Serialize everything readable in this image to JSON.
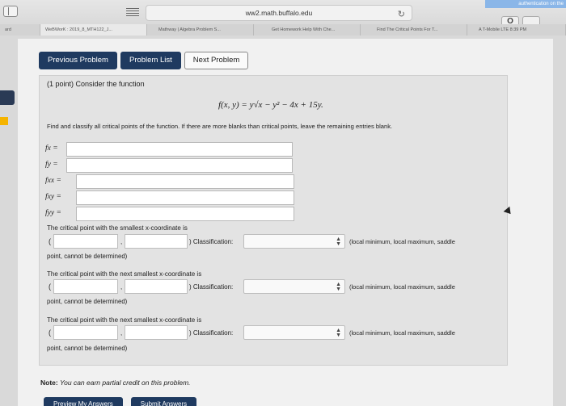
{
  "browser": {
    "url": "ww2.math.buffalo.edu",
    "corner_badge": "authentication on the",
    "corner_btn": "O",
    "tabs": [
      {
        "label": "ard"
      },
      {
        "label": "WeBWorK : 2019_8_MTH122_J..."
      },
      {
        "label": "Mathway | Algebra Problem S..."
      },
      {
        "label": "Get Homework Help With Che..."
      },
      {
        "label": "Find The Critical Points For T..."
      },
      {
        "label": "A T-Mobile LTE 8:39 PM"
      }
    ]
  },
  "nav": {
    "previous": "Previous Problem",
    "list": "Problem List",
    "next": "Next Problem"
  },
  "problem": {
    "points": "(1 point) Consider the function",
    "function": "f(x, y) = y√x − y² − 4x + 15y.",
    "instructions": "Find and classify all critical points of the function. If there are more blanks than critical points, leave the remaining entries blank.",
    "derivatives": [
      {
        "label": "fx =",
        "value": ""
      },
      {
        "label": "fy =",
        "value": ""
      },
      {
        "label": "fxx =",
        "value": ""
      },
      {
        "label": "fxy =",
        "value": ""
      },
      {
        "label": "fyy =",
        "value": ""
      }
    ],
    "critical_points": [
      {
        "title": "The critical point with the smallest x-coordinate is",
        "open": "(",
        "comma": ",",
        "classification_label": ") Classification:",
        "selected": "",
        "options_hint": "(local minimum, local maximum, saddle",
        "options_hint2": "point, cannot be determined)"
      },
      {
        "title": "The critical point with the next smallest x-coordinate is",
        "open": "(",
        "comma": ",",
        "classification_label": ") Classification:",
        "selected": "",
        "options_hint": "(local minimum, local maximum, saddle",
        "options_hint2": "point, cannot be determined)"
      },
      {
        "title": "The critical point with the next smallest x-coordinate is",
        "open": "(",
        "comma": ",",
        "classification_label": ") Classification:",
        "selected": "",
        "options_hint": "(local minimum, local maximum, saddle",
        "options_hint2": "point, cannot be determined)"
      }
    ],
    "note_bold": "Note:",
    "note_text": " You can earn partial credit on this problem."
  },
  "actions": {
    "preview": "Preview My Answers",
    "submit": "Submit Answers"
  },
  "colors": {
    "nav_button": "#1f3a60",
    "panel_bg": "#e3e3e3"
  }
}
